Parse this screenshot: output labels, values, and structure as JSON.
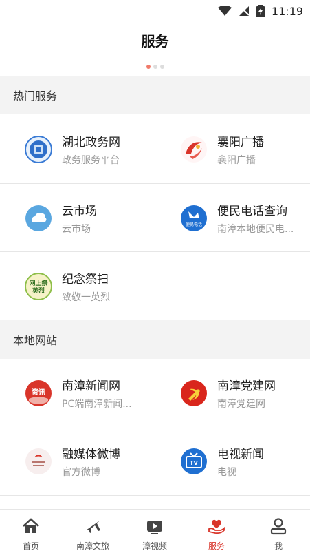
{
  "status_bar": {
    "time": "11:19"
  },
  "header": {
    "title": "服务"
  },
  "sections": {
    "hot": {
      "title": "热门服务",
      "items": [
        {
          "name": "湖北政务网",
          "desc": "政务服务平台"
        },
        {
          "name": "襄阳广播",
          "desc": "襄阳广播"
        },
        {
          "name": "云市场",
          "desc": "云市场"
        },
        {
          "name": "便民电话查询",
          "desc": "南漳本地便民电..."
        },
        {
          "name": "纪念祭扫",
          "desc": "致敬一英烈"
        }
      ]
    },
    "local": {
      "title": "本地网站",
      "items": [
        {
          "name": "南漳新闻网",
          "desc": "PC端南漳新闻..."
        },
        {
          "name": "南漳党建网",
          "desc": "南漳党建网"
        },
        {
          "name": "融媒体微博",
          "desc": "官方微博"
        },
        {
          "name": "电视新闻",
          "desc": "电视"
        }
      ]
    }
  },
  "icons": {
    "hubei": {
      "label": ""
    },
    "memorial": {
      "line1": "网上祭",
      "line2": "英烈"
    },
    "news": {
      "label": "资讯"
    },
    "phone": {
      "label": "便民电话"
    },
    "tv": {
      "label": "TV"
    }
  },
  "tabs": [
    {
      "label": "首页",
      "icon": "home-icon"
    },
    {
      "label": "南漳文旅",
      "icon": "plane-icon"
    },
    {
      "label": "漳视频",
      "icon": "video-icon"
    },
    {
      "label": "服务",
      "icon": "heart-hand-icon",
      "active": true
    },
    {
      "label": "我",
      "icon": "person-icon"
    }
  ],
  "colors": {
    "accent": "#d9352a",
    "divider": "#e6e6e6",
    "section_bg": "#f3f3f3"
  }
}
